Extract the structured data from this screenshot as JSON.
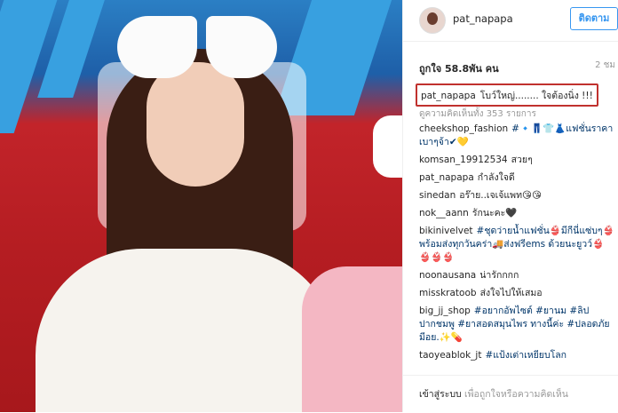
{
  "header": {
    "username": "pat_napapa",
    "follow_label": "ติดตาม"
  },
  "stats": {
    "likes": "ถูกใจ 58.8พัน คน",
    "time": "2 ชม"
  },
  "caption": {
    "user": "pat_napapa",
    "text": "โบว์ใหญ่........ ใจต้องนิ่ง !!!"
  },
  "view_all": "ดูความคิดเห็นทั้ง 353 รายการ",
  "comments": [
    {
      "user": "cheekshop_fashion",
      "text": "#🔹👖👕👗แฟชั่นราคาเบาๆจ้า✔💛"
    },
    {
      "user": "komsan_19912534",
      "text": "สวยๆ"
    },
    {
      "user": "pat_napapa",
      "text": "กำลังใจดี"
    },
    {
      "user": "sinedan",
      "text": "อร๊าย..เจเจ้แพท😘😘"
    },
    {
      "user": "nok__aann",
      "text": "รักนะคะ🖤"
    },
    {
      "user": "bikinivelvet",
      "text": "#ชุดว่ายน้ำแฟชั่น👙มีกีนี่แซ่บๆ👙พร้อมส่งทุกวันคร่า🚚ส่งฟรีems ด้วยนะยูวว์👙👙👙👙"
    },
    {
      "user": "noonausana",
      "text": "น่ารักกกก"
    },
    {
      "user": "misskratoob",
      "text": "ส่งใจไปให้เสมอ"
    },
    {
      "user": "big_jj_shop",
      "text": "#อยากอัพไซต์ #ยานม #ลิปปากชมพู #ยาสอดสมุนไพร ทางนี้ค่ะ #ปลอดภัยมีอย.✨💊"
    },
    {
      "user": "taoyeablok_jt",
      "text": "#แป้งเต่าเหยียบโลก"
    }
  ],
  "footer": {
    "login": "เข้าสู่ระบบ",
    "prompt": "เพื่อถูกใจหรือความคิดเห็น"
  }
}
